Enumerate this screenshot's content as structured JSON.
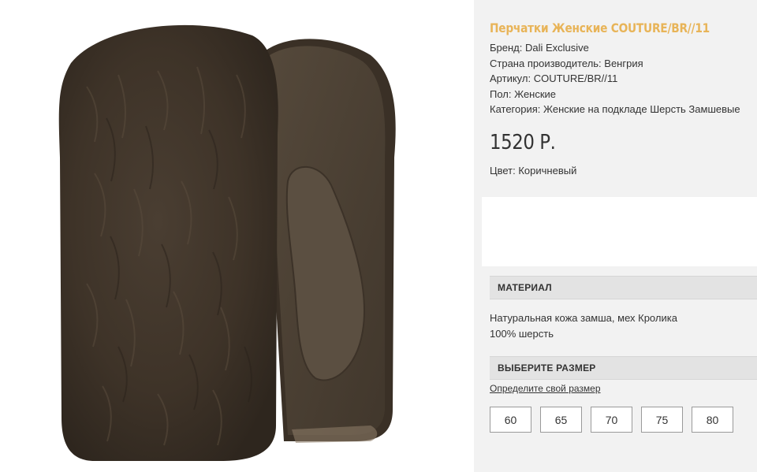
{
  "product": {
    "title": "Перчатки Женские COUTURE/BR//11",
    "properties": [
      {
        "text": "Бренд: Dali Exclusive"
      },
      {
        "text": "Страна производитель: Венгрия"
      },
      {
        "text": "Артикул: COUTURE/BR//11"
      },
      {
        "text": "Пол: Женские"
      },
      {
        "text": "Категория: Женские на подкладе Шерсть Замшевые"
      }
    ],
    "price": "1520 Р.",
    "color": "Цвет: Коричневый"
  },
  "material": {
    "header": "МАТЕРИАЛ",
    "lines": [
      "Натуральная кожа замша, мех Кролика",
      "100% шерсть"
    ]
  },
  "size": {
    "header": "ВЫБЕРИТЕ РАЗМЕР",
    "link": "Определите свой размер",
    "options": [
      "60",
      "65",
      "70",
      "75",
      "80"
    ]
  },
  "colors": {
    "title": "#e8b458",
    "panel_bg": "#f2f2f2",
    "header_bg": "#e3e3e3",
    "fur": "#3e3328",
    "suede": "#4b4033"
  },
  "image": {
    "icon": "fur-mitten-photo"
  }
}
